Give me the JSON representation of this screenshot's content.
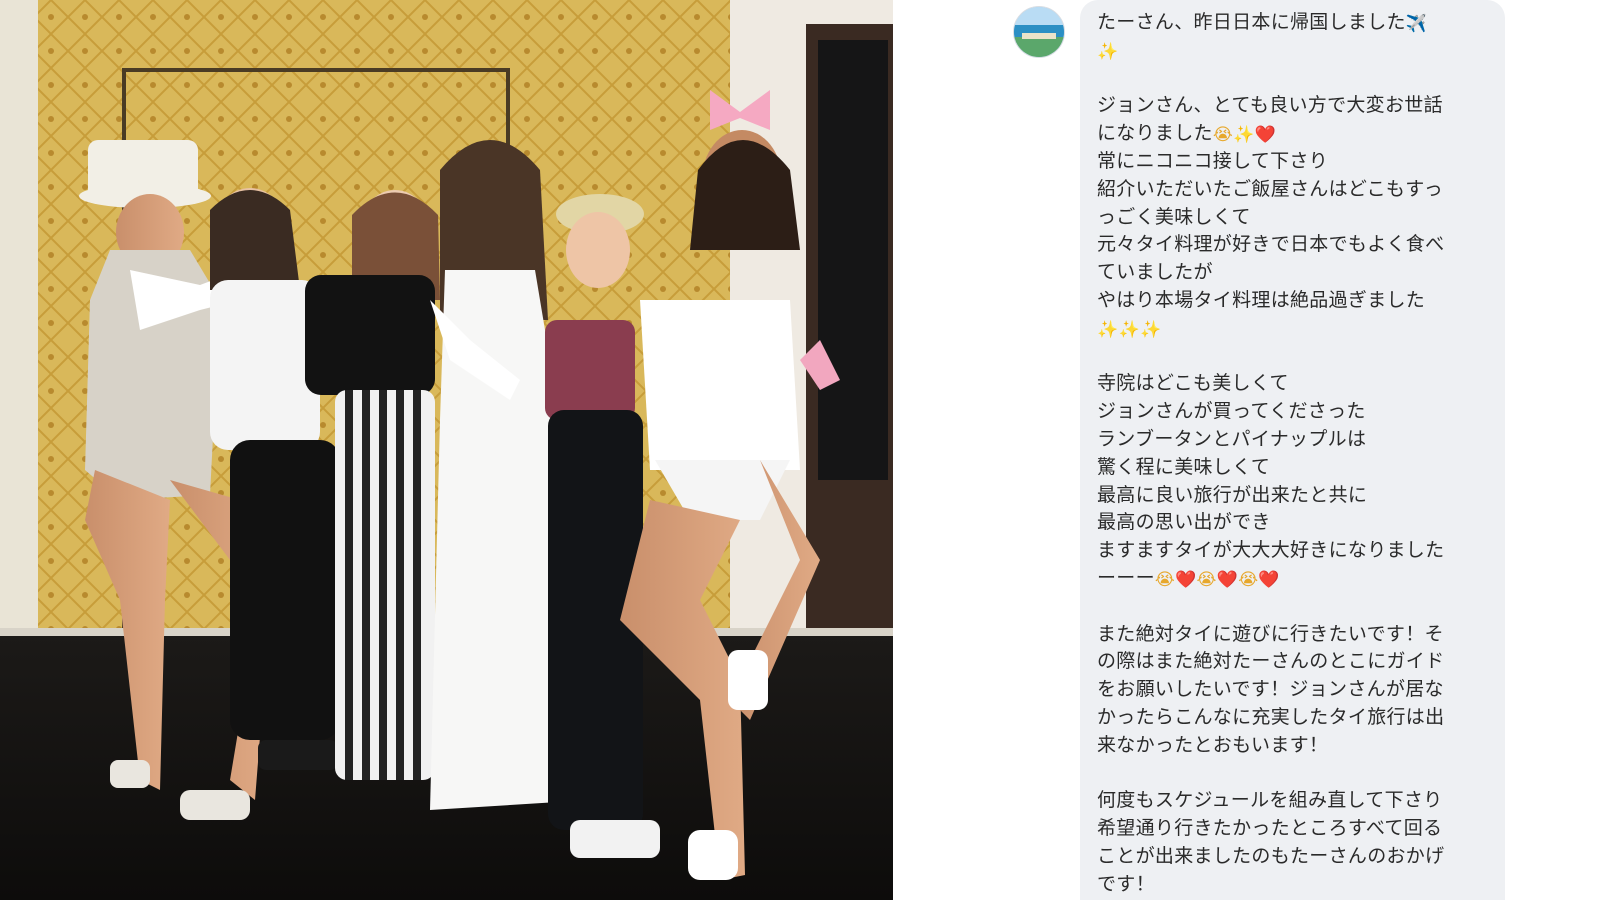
{
  "message": {
    "lines": [
      "たーさん、昨日日本に帰国しました✈️",
      "✨",
      "",
      "ジョンさん、とても良い方で大変お世話",
      "になりました😭✨❤️",
      "常にニコニコ接して下さり",
      "紹介いただいたご飯屋さんはどこもすっ",
      "っごく美味しくて",
      "元々タイ料理が好きで日本でもよく食べ",
      "ていましたが",
      "やはり本場タイ料理は絶品過ぎました",
      "✨✨✨",
      "",
      "寺院はどこも美しくて",
      "ジョンさんが買ってくださった",
      "ランブータンとパイナップルは",
      "驚く程に美味しくて",
      "最高に良い旅行が出来たと共に",
      "最高の思い出ができ",
      "ますますタイが大大大好きになりました",
      "ーーー😭❤️😭❤️😭❤️",
      "",
      "また絶対タイに遊びに行きたいです！そ",
      "の際はまた絶対たーさんのとこにガイド",
      "をお願いしたいです！ジョンさんが居な",
      "かったらこんなに充実したタイ旅行は出",
      "来なかったとおもいます！",
      "",
      "何度もスケジュールを組み直して下さり",
      "希望通り行きたかったところすべて回る",
      "ことが出来ましたのもたーさんのおかげ",
      "です！"
    ]
  },
  "colors": {
    "bubble": "#eef0f3",
    "text": "#2a2a2a",
    "heart": "#e0202c",
    "sparkle": "#f3c623"
  },
  "icons": {
    "avatar": "beach-avatar-icon"
  }
}
